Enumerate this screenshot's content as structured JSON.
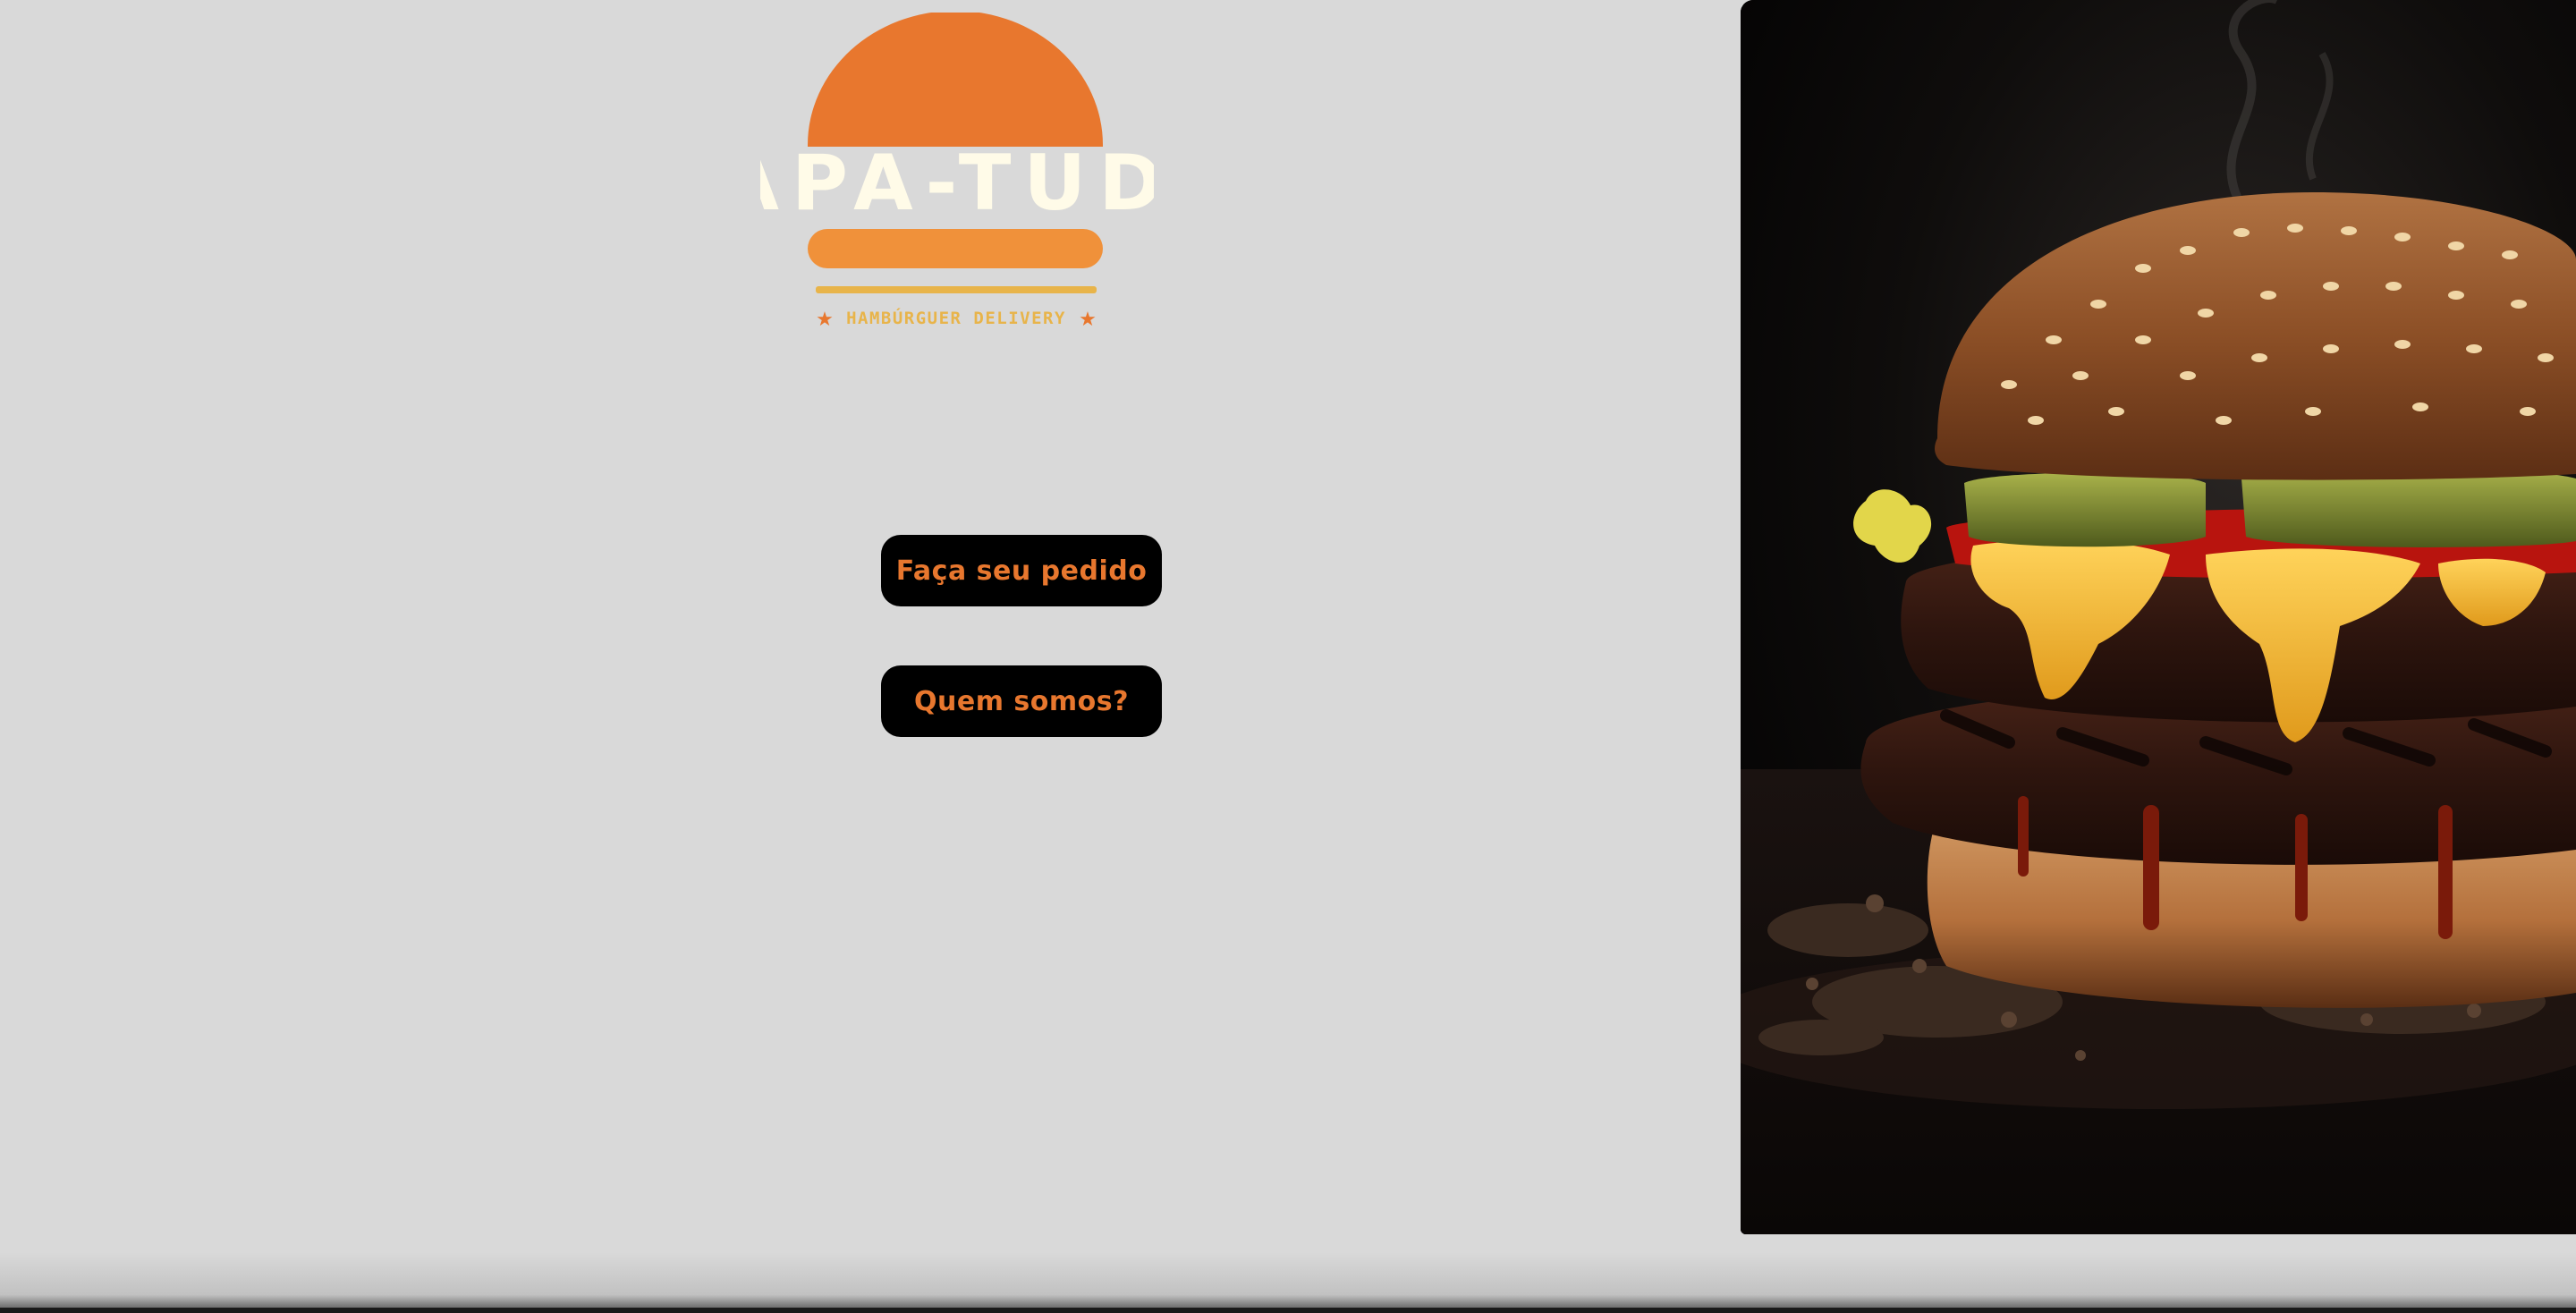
{
  "logo": {
    "brand_name": "PAPA-TUDO",
    "tagline": "HAMBÚRGUER DELIVERY",
    "colors": {
      "bun": "#e8772e",
      "bun_bottom": "#f0913a",
      "name_text": "#fffbe8",
      "tagline": "#e8b44a",
      "stars": "#e8772e"
    }
  },
  "buttons": {
    "order_label": "Faça seu pedido",
    "about_label": "Quem somos?"
  },
  "hero": {
    "image_subject": "double-cheeseburger-photo"
  },
  "theme": {
    "background": "#d9d9d9",
    "button_bg": "#000000",
    "button_text": "#e8772e"
  }
}
